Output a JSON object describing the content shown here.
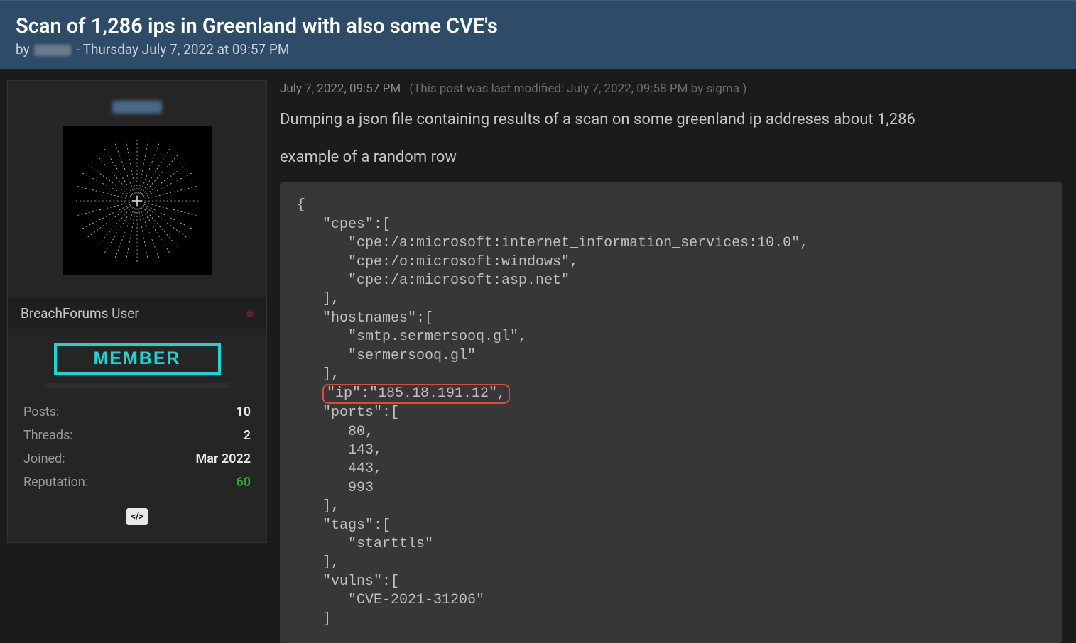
{
  "header": {
    "title": "Scan of 1,286 ips in Greenland with also some CVE's",
    "by_prefix": "by",
    "timestamp_sep": "-",
    "timestamp": "Thursday July 7, 2022 at 09:57 PM"
  },
  "user": {
    "rank": "BreachForums User",
    "badge": "MEMBER",
    "stats": {
      "posts_label": "Posts:",
      "posts_value": "10",
      "threads_label": "Threads:",
      "threads_value": "2",
      "joined_label": "Joined:",
      "joined_value": "Mar 2022",
      "reputation_label": "Reputation:",
      "reputation_value": "60"
    },
    "code_icon_label": "</>"
  },
  "post": {
    "timestamp": "July 7, 2022, 09:57 PM",
    "modified_note": "(This post was last modified: July 7, 2022, 09:58 PM by sigma.)",
    "body_line1": "Dumping a json file containing results of a scan on some greenland ip addreses about 1,286",
    "body_line2": "example of a random row",
    "code": {
      "l01": "{",
      "l02": "   \"cpes\":[",
      "l03": "      \"cpe:/a:microsoft:internet_information_services:10.0\",",
      "l04": "      \"cpe:/o:microsoft:windows\",",
      "l05": "      \"cpe:/a:microsoft:asp.net\"",
      "l06": "   ],",
      "l07": "   \"hostnames\":[",
      "l08": "      \"smtp.sermersooq.gl\",",
      "l09": "      \"sermersooq.gl\"",
      "l10": "   ],",
      "l11_pad": "   ",
      "l11_ip": "\"ip\":\"185.18.191.12\",",
      "l12": "   \"ports\":[",
      "l13": "      80,",
      "l14": "      143,",
      "l15": "      443,",
      "l16": "      993",
      "l17": "   ],",
      "l18": "   \"tags\":[",
      "l19": "      \"starttls\"",
      "l20": "   ],",
      "l21": "   \"vulns\":[",
      "l22": "      \"CVE-2021-31206\"",
      "l23": "   ]"
    }
  }
}
